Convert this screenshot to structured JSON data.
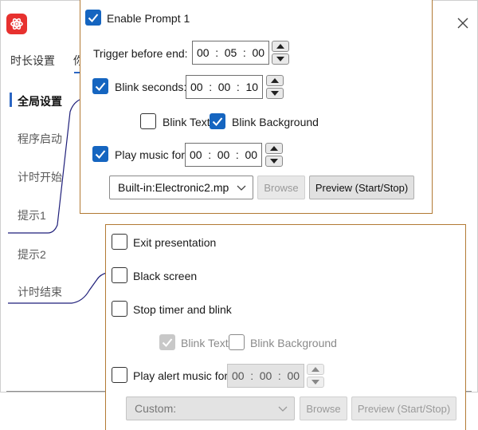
{
  "window": {
    "tabs": [
      {
        "label": "时长设置"
      },
      {
        "label": "你"
      }
    ],
    "sidebar": [
      {
        "label": "全局设置"
      },
      {
        "label": "程序启动"
      },
      {
        "label": "计时开始"
      },
      {
        "label": "提示1"
      },
      {
        "label": "提示2"
      },
      {
        "label": "计时结束"
      }
    ]
  },
  "prompt1": {
    "enable_label": "Enable Prompt 1",
    "enable_checked": true,
    "trigger_label": "Trigger before end:",
    "trigger_time": [
      "00",
      "05",
      "00"
    ],
    "blink_label": "Blink  seconds:",
    "blink_checked": true,
    "blink_time": [
      "00",
      "00",
      "10"
    ],
    "blink_text_label": "Blink Text",
    "blink_text_checked": false,
    "blink_bg_label": "Blink Background",
    "blink_bg_checked": true,
    "music_label": "Play music for:",
    "music_checked": true,
    "music_time": [
      "00",
      "00",
      "00"
    ],
    "music_file": "Built-in:Electronic2.mp",
    "browse_label": "Browse",
    "preview_label": "Preview (Start/Stop)"
  },
  "end": {
    "exit_label": "Exit presentation",
    "exit_checked": false,
    "black_label": "Black screen",
    "black_checked": false,
    "stop_label": "Stop timer and blink",
    "stop_checked": false,
    "blink_text_label": "Blink Text",
    "blink_text_checked": true,
    "blink_bg_label": "Blink Background",
    "blink_bg_checked": false,
    "alert_label": "Play alert music for:",
    "alert_checked": false,
    "alert_time": [
      "00",
      "00",
      "00"
    ],
    "music_file": "Custom:",
    "browse_label": "Browse",
    "preview_label": "Preview (Start/Stop)"
  },
  "colors": {
    "accent": "#1565c0",
    "panel_border": "#b27a34",
    "callout_line": "#1f1f7a",
    "app_icon": "#e7312f"
  }
}
